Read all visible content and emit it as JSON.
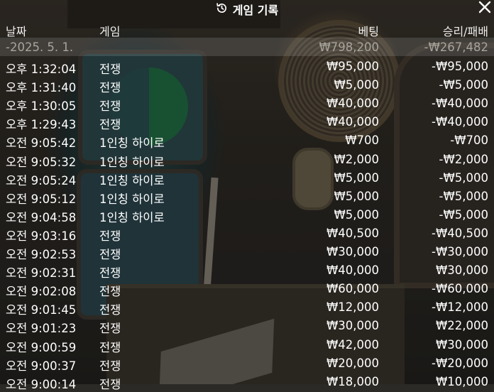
{
  "title": "게임 기록",
  "columns": {
    "date": "날짜",
    "game": "게임",
    "bet": "베팅",
    "result": "승리/패배"
  },
  "day_summary": {
    "date": "-2025. 5. 1.",
    "bet": "₩798,200",
    "result": "-₩267,482"
  },
  "rows": [
    {
      "time": "오후 1:32:04",
      "game": "전쟁",
      "bet": "₩95,000",
      "result": "-₩95,000"
    },
    {
      "time": "오후 1:31:40",
      "game": "전쟁",
      "bet": "₩5,000",
      "result": "-₩5,000"
    },
    {
      "time": "오후 1:30:05",
      "game": "전쟁",
      "bet": "₩40,000",
      "result": "-₩40,000"
    },
    {
      "time": "오후 1:29:43",
      "game": "전쟁",
      "bet": "₩40,000",
      "result": "-₩40,000"
    },
    {
      "time": "오전 9:05:42",
      "game": "1인칭 하이로",
      "bet": "₩700",
      "result": "-₩700"
    },
    {
      "time": "오전 9:05:32",
      "game": "1인칭 하이로",
      "bet": "₩2,000",
      "result": "-₩2,000"
    },
    {
      "time": "오전 9:05:24",
      "game": "1인칭 하이로",
      "bet": "₩5,000",
      "result": "-₩5,000"
    },
    {
      "time": "오전 9:05:12",
      "game": "1인칭 하이로",
      "bet": "₩5,000",
      "result": "-₩5,000"
    },
    {
      "time": "오전 9:04:58",
      "game": "1인칭 하이로",
      "bet": "₩5,000",
      "result": "-₩5,000"
    },
    {
      "time": "오전 9:03:16",
      "game": "전쟁",
      "bet": "₩40,500",
      "result": "-₩40,500"
    },
    {
      "time": "오전 9:02:53",
      "game": "전쟁",
      "bet": "₩30,000",
      "result": "-₩30,000"
    },
    {
      "time": "오전 9:02:31",
      "game": "전쟁",
      "bet": "₩40,000",
      "result": "₩30,000"
    },
    {
      "time": "오전 9:02:08",
      "game": "전쟁",
      "bet": "₩60,000",
      "result": "-₩60,000"
    },
    {
      "time": "오전 9:01:45",
      "game": "전쟁",
      "bet": "₩12,000",
      "result": "-₩12,000"
    },
    {
      "time": "오전 9:01:23",
      "game": "전쟁",
      "bet": "₩30,000",
      "result": "₩22,000"
    },
    {
      "time": "오전 9:00:59",
      "game": "전쟁",
      "bet": "₩42,000",
      "result": "₩30,000"
    },
    {
      "time": "오전 9:00:37",
      "game": "전쟁",
      "bet": "₩20,000",
      "result": "-₩20,000"
    },
    {
      "time": "오전 9:00:14",
      "game": "전쟁",
      "bet": "₩18,000",
      "result": "₩10,000"
    }
  ],
  "icons": {
    "title": "history-icon",
    "close": "close-icon"
  }
}
